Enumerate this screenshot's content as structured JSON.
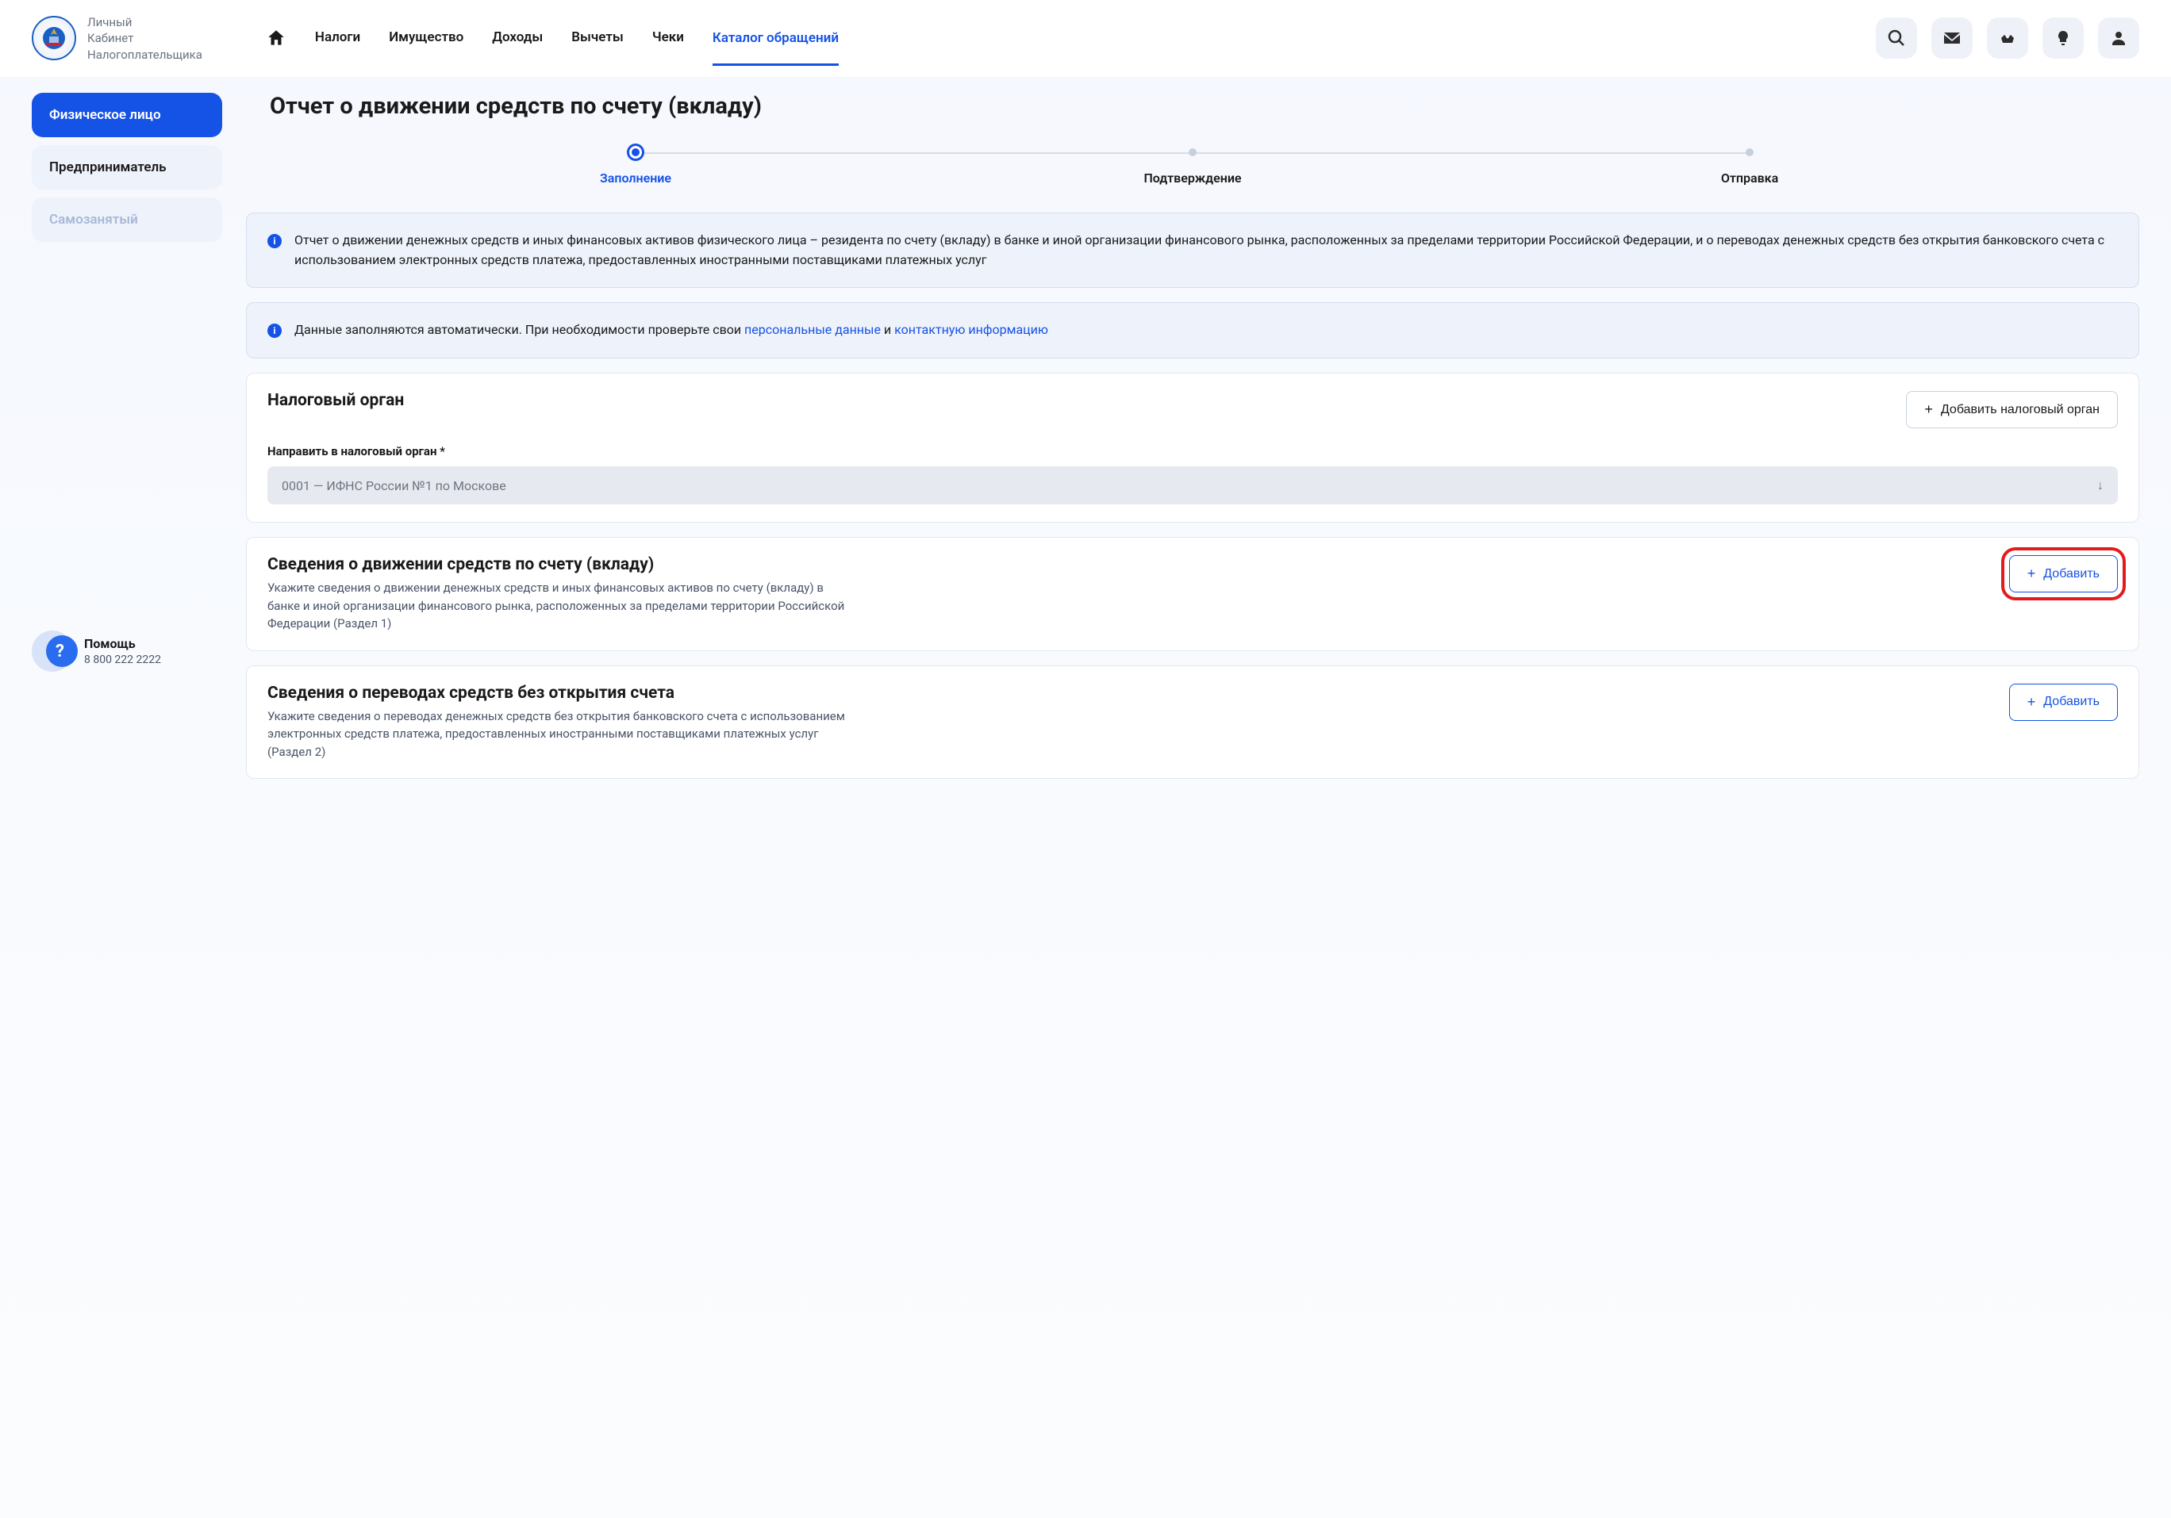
{
  "brand": {
    "line1": "Личный",
    "line2": "Кабинет",
    "line3": "Налогоплательщика"
  },
  "nav": {
    "taxes": "Налоги",
    "property": "Имущество",
    "income": "Доходы",
    "deductions": "Вычеты",
    "receipts": "Чеки",
    "catalog": "Каталог обращений"
  },
  "sidebar": {
    "individual": "Физическое лицо",
    "entrepreneur": "Предприниматель",
    "self_employed": "Самозанятый"
  },
  "page": {
    "title": "Отчет о движении средств по счету (вкладу)"
  },
  "steps": {
    "s1": "Заполнение",
    "s2": "Подтверждение",
    "s3": "Отправка"
  },
  "info1": "Отчет о движении денежных средств и иных финансовых активов физического лица – резидента по счету (вкладу) в банке и иной организации финансового рынка, расположенных за пределами территории Российской Федерации, и о переводах денежных средств без открытия банковского счета с использованием электронных средств платежа, предоставленных иностранными поставщиками платежных услуг",
  "info2": {
    "pre": "Данные заполняются автоматически. При необходимости проверьте свои ",
    "link1": "персональные данные",
    "mid": " и ",
    "link2": "контактную информацию"
  },
  "section1": {
    "title": "Налоговый орган",
    "btn": "Добавить налоговый орган",
    "field_label": "Направить в налоговый орган *",
    "select_value": "0001 — ИФНС России №1 по Москове"
  },
  "section2": {
    "title": "Сведения о движении средств по счету (вкладу)",
    "sub": "Укажите сведения о движении денежных средств и иных финансовых активов по счету (вкладу) в банке и иной организации финансового рынка, расположенных за пределами территории Российской Федерации (Раздел 1)",
    "btn": "Добавить"
  },
  "section3": {
    "title": "Сведения о переводах средств без открытия счета",
    "sub": "Укажите сведения о переводах денежных средств без открытия банковского счета с использованием электронных средств платежа, предоставленных иностранными поставщиками платежных услуг (Раздел 2)",
    "btn": "Добавить"
  },
  "help": {
    "title": "Помощь",
    "phone": "8 800 222 2222"
  }
}
